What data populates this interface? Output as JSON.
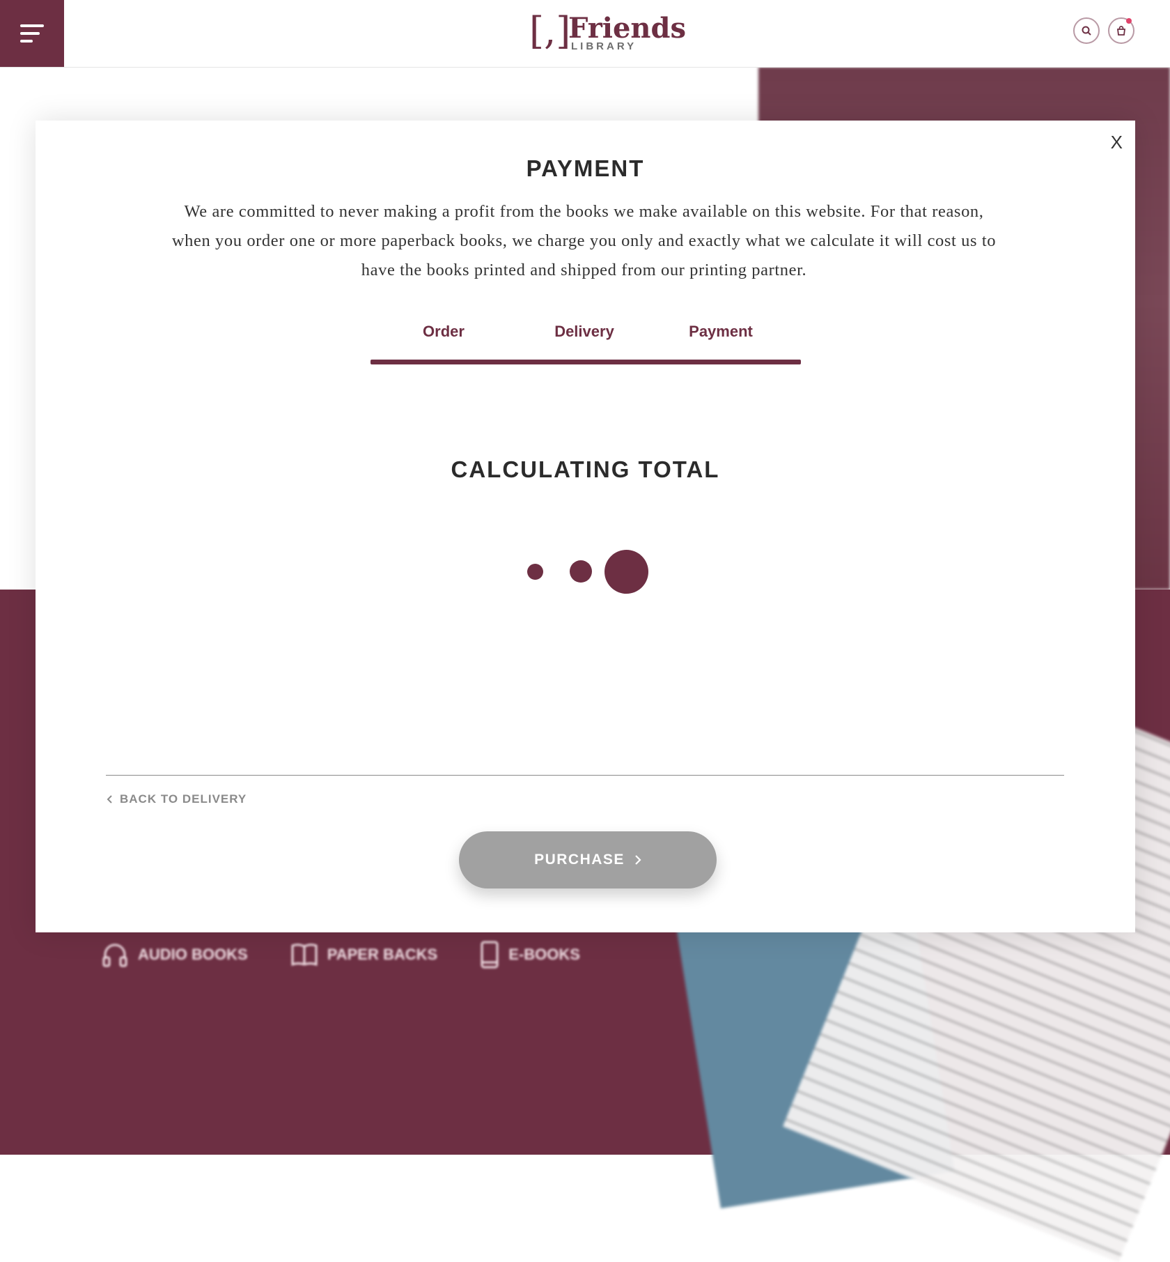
{
  "colors": {
    "brand": "#6d2f43",
    "disabled_button": "#a1a1a1",
    "book_cover": "#6389a0"
  },
  "header": {
    "logo_mark": "[,]",
    "logo_name": "Friends",
    "logo_sub": "LIBRARY",
    "icons": [
      "menu-icon",
      "search-icon",
      "cart-icon"
    ]
  },
  "background": {
    "categories": [
      {
        "label": "AUDIO BOOKS",
        "icon": "headphones-icon"
      },
      {
        "label": "PAPER BACKS",
        "icon": "book-icon"
      },
      {
        "label": "E-BOOKS",
        "icon": "tablet-icon"
      }
    ]
  },
  "modal": {
    "close_label": "X",
    "title": "PAYMENT",
    "intro": "We are committed to never making a profit from the books we make available on this website. For that reason, when you order one or more paperback books, we charge you only and exactly what we calculate it will cost us to have the books printed and shipped from our printing partner.",
    "steps": [
      "Order",
      "Delivery",
      "Payment"
    ],
    "progress": 1.0,
    "status": "CALCULATING TOTAL",
    "back_label": "BACK TO DELIVERY",
    "purchase_label": "PURCHASE"
  }
}
